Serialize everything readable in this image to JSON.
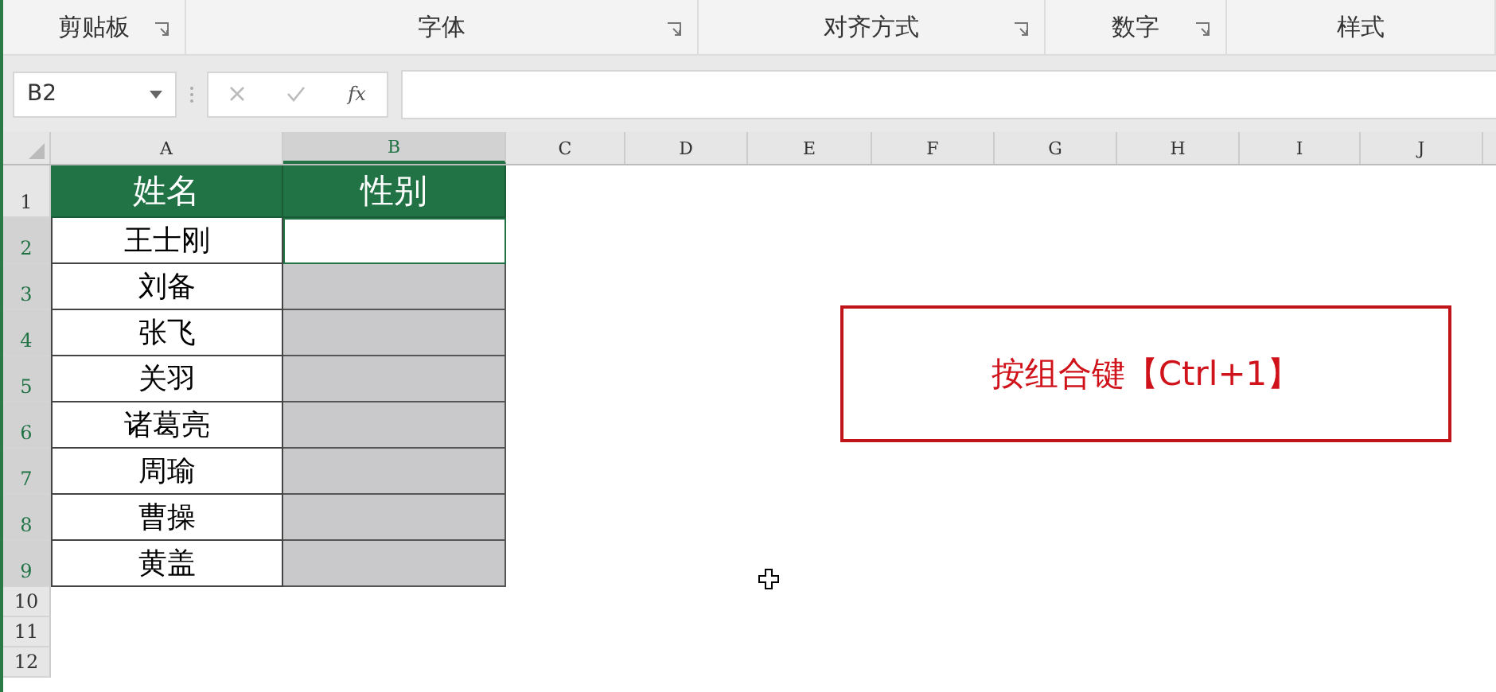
{
  "ribbon_groups": [
    {
      "label": "剪贴板",
      "launcher": true
    },
    {
      "label": "字体",
      "launcher": true
    },
    {
      "label": "对齐方式",
      "launcher": true
    },
    {
      "label": "数字",
      "launcher": true
    },
    {
      "label": "样式",
      "launcher": false
    }
  ],
  "name_box": {
    "value": "B2"
  },
  "formula_bar": {
    "function_button": "fx"
  },
  "columns": [
    {
      "label": "A",
      "selected": false
    },
    {
      "label": "B",
      "selected": true
    },
    {
      "label": "C",
      "selected": false
    },
    {
      "label": "D",
      "selected": false
    },
    {
      "label": "E",
      "selected": false
    },
    {
      "label": "F",
      "selected": false
    },
    {
      "label": "G",
      "selected": false
    },
    {
      "label": "H",
      "selected": false
    },
    {
      "label": "I",
      "selected": false
    },
    {
      "label": "J",
      "selected": false
    }
  ],
  "header_row": {
    "row": "1",
    "cells": [
      "姓名",
      "性别"
    ]
  },
  "rows": [
    {
      "row": "2",
      "name": "王士刚",
      "selected": true,
      "active": true
    },
    {
      "row": "3",
      "name": "刘备",
      "selected": true,
      "active": false
    },
    {
      "row": "4",
      "name": "张飞",
      "selected": true,
      "active": false
    },
    {
      "row": "5",
      "name": "关羽",
      "selected": true,
      "active": false
    },
    {
      "row": "6",
      "name": "诸葛亮",
      "selected": true,
      "active": false
    },
    {
      "row": "7",
      "name": "周瑜",
      "selected": true,
      "active": false
    },
    {
      "row": "8",
      "name": "曹操",
      "selected": true,
      "active": false
    },
    {
      "row": "9",
      "name": "黄盖",
      "selected": true,
      "active": false
    }
  ],
  "empty_rows": [
    "10",
    "11",
    "12"
  ],
  "callout": {
    "text": "按组合键【Ctrl+1】"
  }
}
